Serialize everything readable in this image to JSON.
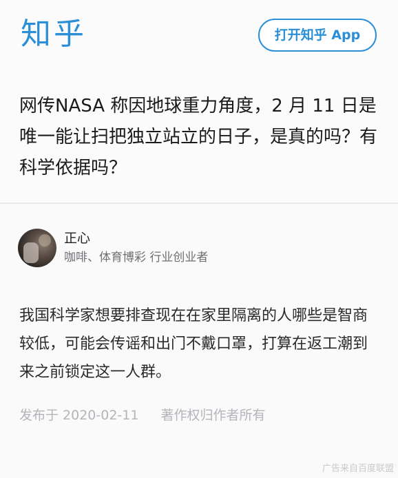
{
  "header": {
    "logo_text": "知乎",
    "open_app_label": "打开知乎 App"
  },
  "question": {
    "title": "网传NASA 称因地球重力角度，2 月 11 日是唯一能让扫把独立站立的日子，是真的吗？有科学依据吗？"
  },
  "author": {
    "name": "正心",
    "bio": "咖啡、体育博彩 行业创业者"
  },
  "answer": {
    "body": "我国科学家想要排查现在在家里隔离的人哪些是智商较低，可能会传谣和出门不戴口罩，打算在返工潮到来之前锁定这一人群。",
    "published": "发布于 2020-02-11",
    "copyright": "著作权归作者所有"
  },
  "footer": {
    "ad_note": "广告来自百度联盟"
  },
  "colors": {
    "brand": "#2a8fd6",
    "text": "#1a1a1a",
    "muted": "#b4b4ba"
  }
}
